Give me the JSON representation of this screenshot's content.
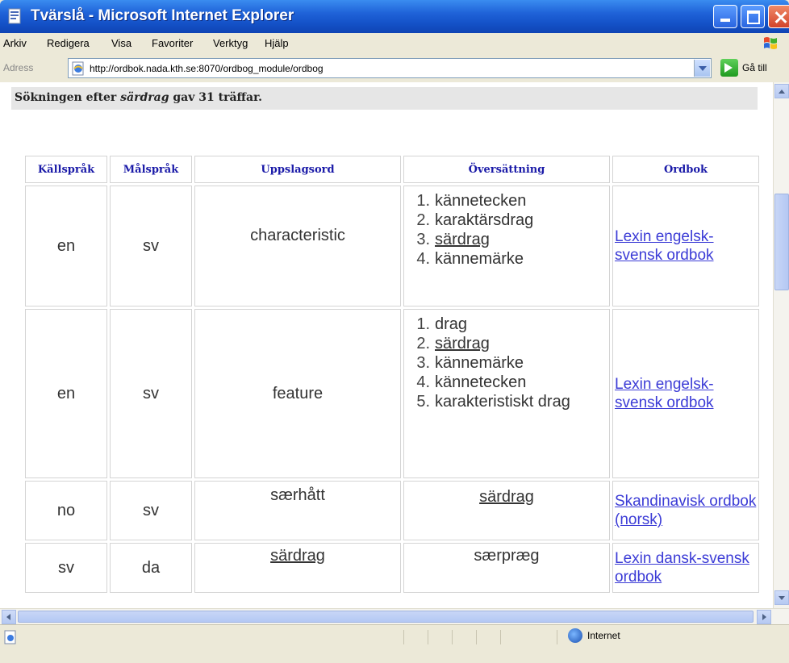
{
  "window": {
    "title": "Tvärslå - Microsoft Internet Explorer"
  },
  "menu": [
    "Arkiv",
    "Redigera",
    "Visa",
    "Favoriter",
    "Verktyg",
    "Hjälp"
  ],
  "address": {
    "label": "Adress",
    "url": "http://ordbok.nada.kth.se:8070/ordbog_module/ordbog",
    "go_label": "Gå till"
  },
  "search": {
    "prefix": "Sökningen efter ",
    "term": "särdrag",
    "suffix": " gav 31 träffar."
  },
  "table": {
    "headers": {
      "source": "Källspråk",
      "target": "Målspråk",
      "headword": "Uppslagsord",
      "translation": "Översättning",
      "dictionary": "Ordbok"
    },
    "rows": [
      {
        "source": "en",
        "target": "sv",
        "headword": "characteristic",
        "translations": [
          "kännetecken",
          "karaktärsdrag",
          "särdrag",
          "kännemärke"
        ],
        "dictionary": "Lexin engelsk-svensk ordbok"
      },
      {
        "source": "en",
        "target": "sv",
        "headword": "feature",
        "translations": [
          "drag",
          "särdrag",
          "kännemärke",
          "kännetecken",
          "karakteristiskt drag"
        ],
        "dictionary": "Lexin engelsk-svensk ordbok"
      },
      {
        "source": "no",
        "target": "sv",
        "headword": "særhått",
        "translation_single": "särdrag",
        "dictionary": "Skandinavisk ordbok (norsk)"
      },
      {
        "source": "sv",
        "target": "da",
        "headword": "särdrag",
        "translation_single": "særpræg",
        "dictionary": "Lexin dansk-svensk ordbok"
      }
    ]
  },
  "status": {
    "zone": "Internet"
  }
}
